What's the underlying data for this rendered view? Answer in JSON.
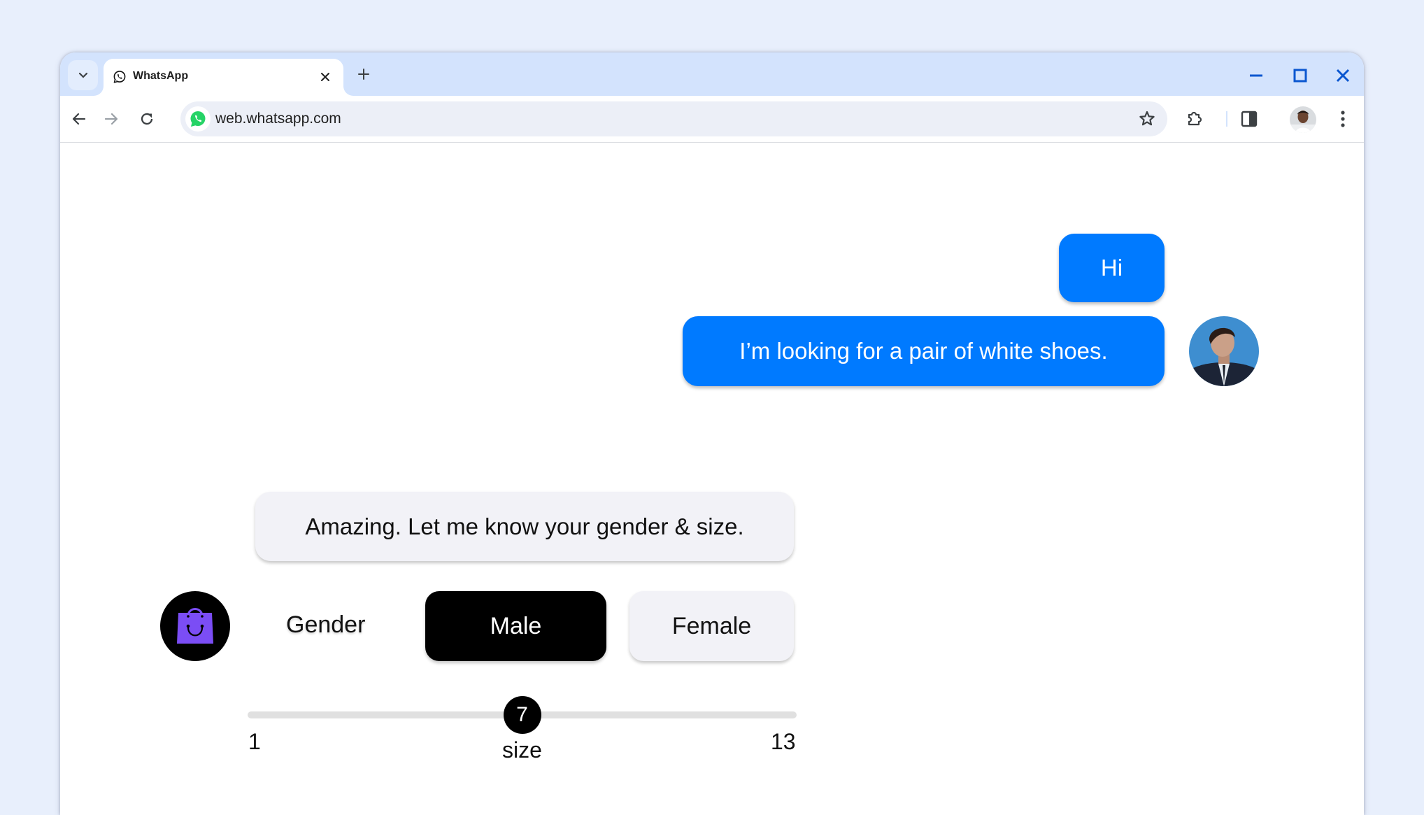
{
  "browser": {
    "tab": {
      "title": "WhatsApp",
      "favicon": "whatsapp-icon"
    },
    "url": "web.whatsapp.com",
    "icons": {
      "tab_search": "chevron-down-icon",
      "new_tab": "plus-icon",
      "minimize": "minimize-icon",
      "maximize": "maximize-icon",
      "close": "close-icon",
      "back": "arrow-left-icon",
      "forward": "arrow-right-icon",
      "reload": "reload-icon",
      "bookmark": "star-icon",
      "extensions": "puzzle-icon",
      "side_panel": "side-panel-icon",
      "menu": "kebab-menu-icon"
    }
  },
  "chat": {
    "messages": [
      {
        "sender": "user",
        "text": "Hi"
      },
      {
        "sender": "user",
        "text": "I’m looking for a pair of white shoes."
      },
      {
        "sender": "bot",
        "text": "Amazing. Let me know your gender & size."
      }
    ],
    "gender": {
      "label": "Gender",
      "options": [
        "Male",
        "Female"
      ],
      "selected": "Male"
    },
    "size_slider": {
      "caption": "size",
      "min": 1,
      "max": 13,
      "value": 7,
      "min_label": "1",
      "max_label": "13",
      "value_label": "7"
    },
    "colors": {
      "user_bubble": "#007AFF",
      "bot_bubble": "#F2F2F7",
      "selected_option": "#000000",
      "bot_icon": "#7B4DF5"
    }
  }
}
